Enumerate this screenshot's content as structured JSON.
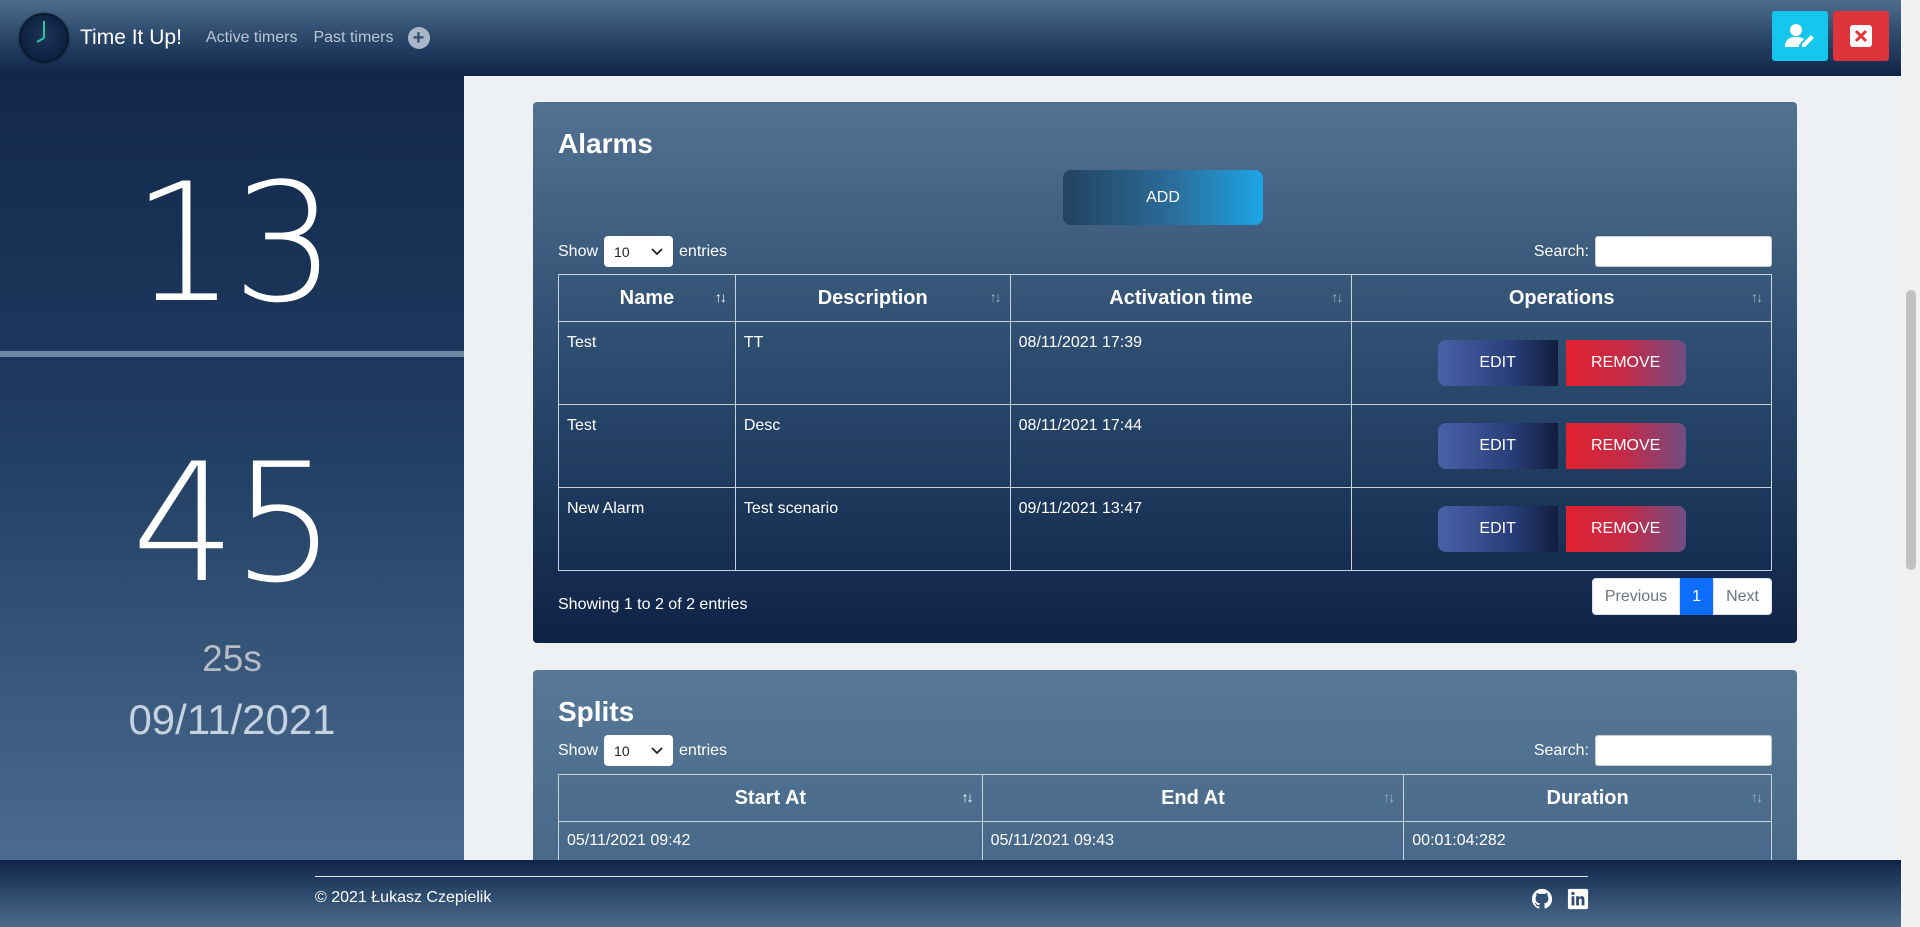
{
  "app": {
    "brand": "Time It Up!",
    "nav_active": "Active timers",
    "nav_past": "Past timers"
  },
  "timer": {
    "hours": "13",
    "minutes": "45",
    "seconds": "25s",
    "date": "09/11/2021"
  },
  "alarms": {
    "title": "Alarms",
    "add_label": "ADD",
    "show_label": "Show",
    "entries_value": "10",
    "entries_label": "entries",
    "search_label": "Search:",
    "columns": [
      "Name",
      "Description",
      "Activation time",
      "Operations"
    ],
    "rows": [
      {
        "name": "Test",
        "description": "TT",
        "time": "08/11/2021 17:39"
      },
      {
        "name": "Test",
        "description": "Desc",
        "time": "08/11/2021 17:44"
      },
      {
        "name": "New Alarm",
        "description": "Test scenario",
        "time": "09/11/2021 13:47"
      }
    ],
    "edit_label": "EDIT",
    "remove_label": "REMOVE",
    "showing": "Showing 1 to 2 of 2 entries",
    "prev_label": "Previous",
    "page": "1",
    "next_label": "Next"
  },
  "splits": {
    "title": "Splits",
    "show_label": "Show",
    "entries_value": "10",
    "entries_label": "entries",
    "search_label": "Search:",
    "columns": [
      "Start At",
      "End At",
      "Duration"
    ],
    "rows": [
      {
        "start": "05/11/2021 09:42",
        "end": "05/11/2021 09:43",
        "duration": "00:01:04:282"
      }
    ]
  },
  "footer": {
    "copyright": "© 2021 Łukasz Czepielik"
  },
  "icons": {
    "user_edit": "user-edit-icon",
    "close": "close-icon",
    "github": "github-icon",
    "linkedin": "linkedin-icon"
  },
  "colors": {
    "accent_cyan": "#17c6ec",
    "danger_red": "#e0343d",
    "page_active": "#0d6efd"
  }
}
